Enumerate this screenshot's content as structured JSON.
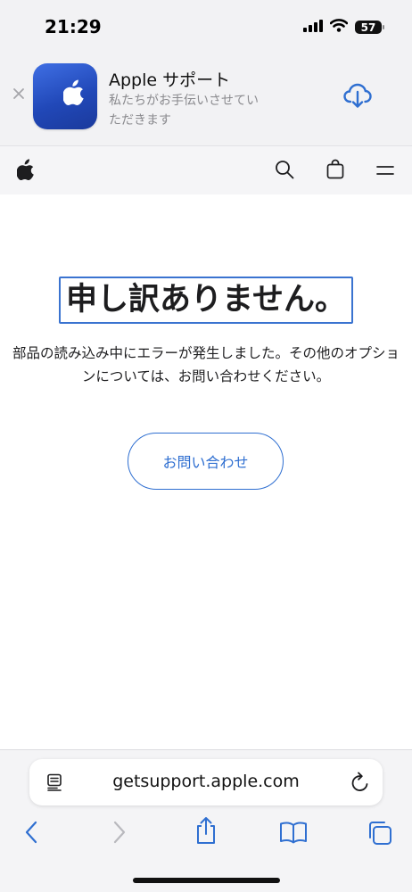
{
  "status_bar": {
    "time": "21:29",
    "battery": "57",
    "icons": [
      "signal-icon",
      "wifi-icon",
      "battery-icon"
    ]
  },
  "app_banner": {
    "title": "Apple サポート",
    "subtitle": "私たちがお手伝いさせていただきます",
    "icons": [
      "close-icon",
      "apple-logo-icon",
      "cloud-download-icon"
    ]
  },
  "nav": {
    "icons": [
      "apple-logo-icon",
      "search-icon",
      "bag-icon",
      "menu-icon"
    ]
  },
  "main": {
    "headline": "申し訳ありません。",
    "message_line1": "部品の読み込み中にエラーが発生しました。その他のオプショ",
    "message_line2": "ンについては、お問い合わせください。",
    "contact_button": "お問い合わせ"
  },
  "browser": {
    "url": "getsupport.apple.com",
    "icons": [
      "reader-icon",
      "reload-icon",
      "back-icon",
      "forward-icon",
      "share-icon",
      "bookmarks-icon",
      "tabs-icon"
    ]
  },
  "colors": {
    "accent": "#2f6fd1",
    "text": "#1d1d1f",
    "disabled": "#b9b9be"
  }
}
